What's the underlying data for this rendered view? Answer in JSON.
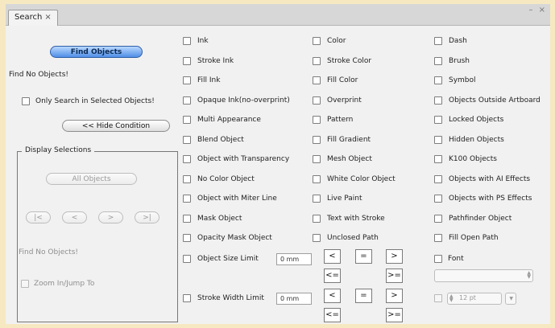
{
  "tab": {
    "title": "Search",
    "close_glyph": "×"
  },
  "window_controls": "– ×",
  "left": {
    "find_button": "Find Objects",
    "status": "Find No Objects!",
    "only_selected": "Only Search in Selected Objects!",
    "hide_condition": "<< Hide Condition",
    "display_group": {
      "legend": "Display Selections",
      "all_objects": "All Objects",
      "nav": [
        "|<",
        "<",
        ">",
        ">|"
      ],
      "status": "Find No Objects!",
      "zoom": "Zoom In/Jump To"
    }
  },
  "col1": [
    "Ink",
    "Stroke Ink",
    "Fill Ink",
    "Opaque Ink(no-overprint)",
    "Multi Appearance",
    "Blend Object",
    "Object with Transparency",
    "No Color Object",
    "Object with Miter Line",
    "Mask Object",
    "Opacity Mask Object"
  ],
  "col2": [
    "Color",
    "Stroke Color",
    "Fill Color",
    "Overprint",
    "Pattern",
    "Fill Gradient",
    "Mesh Object",
    "White Color Object",
    "Live Paint",
    "Text with Stroke",
    "Unclosed Path"
  ],
  "col3": [
    "Dash",
    "Brush",
    "Symbol",
    "Objects Outside Artboard",
    "Locked Objects",
    "Hidden Objects",
    "K100 Objects",
    "Objects with AI Effects",
    "Objects with PS Effects",
    "Pathfinder Object",
    "Fill Open Path"
  ],
  "size_limit": {
    "label": "Object Size Limit",
    "value": "0 mm"
  },
  "stroke_limit": {
    "label": "Stroke Width Limit",
    "value": "0 mm"
  },
  "compare": {
    "lt": "<",
    "eq": "=",
    "gt": ">",
    "le": "<=",
    "ge": ">="
  },
  "font": {
    "label": "Font",
    "size_value": "12 pt"
  }
}
